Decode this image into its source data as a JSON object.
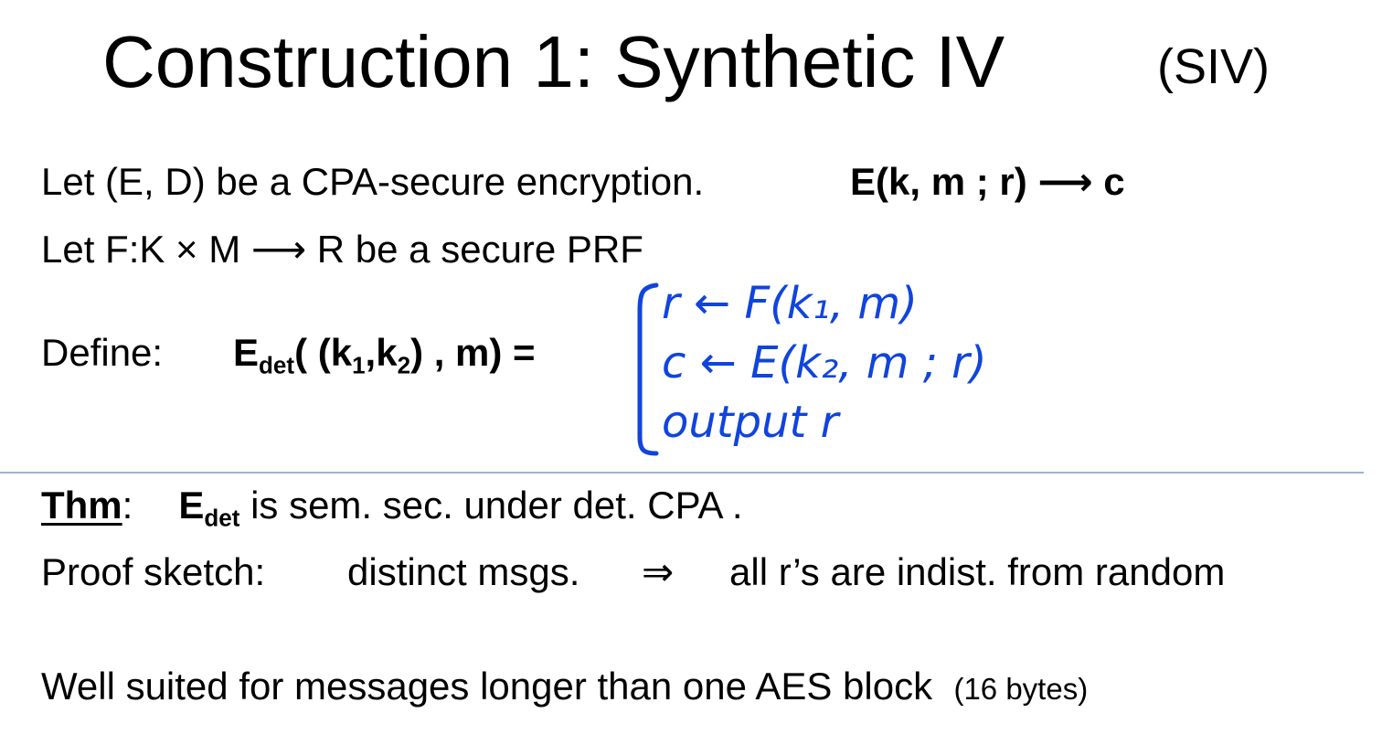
{
  "title": {
    "main": "Construction 1:  Synthetic IV",
    "abbrev": "(SIV)"
  },
  "lines": {
    "let_e": "Let  (E, D) be a CPA-secure encryption.",
    "enc_sig": "E(k, m  ;  r) ⟶ c",
    "let_f": "Let   F:K × M ⟶ R   be a secure PRF",
    "define_label": "Define:",
    "edet_E": "E",
    "edet_sub": "det",
    "edet_open": "( (k",
    "k1_sub": "1",
    "comma": ",k",
    "k2_sub": "2",
    "edet_close": ") , m) ="
  },
  "handwriting": {
    "line1": "r ← F(k₁, m)",
    "line2": "c ← E(k₂, m ; r)",
    "line3": "output  r",
    "ink_color": "#1044dd"
  },
  "theorem": {
    "label": "Thm",
    "colon": ":",
    "E": "E",
    "sub": "det",
    "text": "is sem. sec. under det. CPA ."
  },
  "proof": {
    "label": "Proof sketch:",
    "premise": "distinct msgs.",
    "arrow": "⇒",
    "conclusion": "all r’s are indist. from random"
  },
  "note": {
    "main": "Well suited for messages longer than one AES block",
    "paren": "(16 bytes)"
  },
  "colors": {
    "divider": "#9db3d2",
    "text": "#000000"
  }
}
